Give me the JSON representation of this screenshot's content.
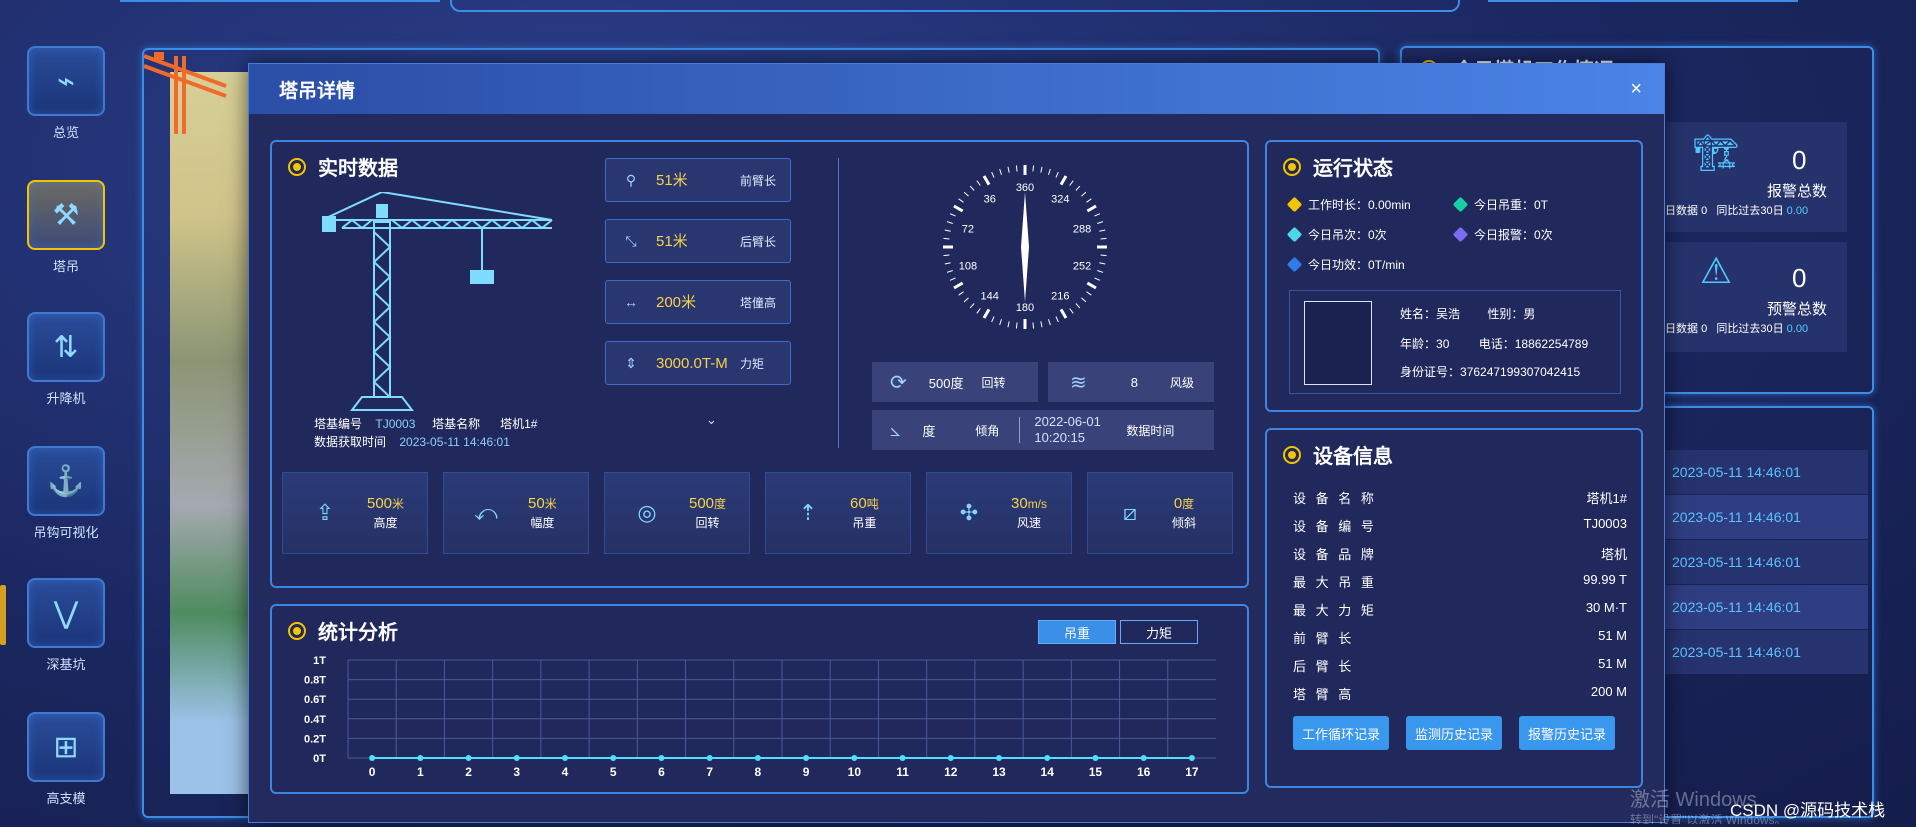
{
  "nav": [
    {
      "label": "总览",
      "icon": "monitor-icon"
    },
    {
      "label": "塔吊",
      "icon": "tower-crane-icon"
    },
    {
      "label": "升降机",
      "icon": "elevator-icon"
    },
    {
      "label": "吊钩可视化",
      "icon": "hook-icon"
    },
    {
      "label": "深基坑",
      "icon": "foundation-pit-icon"
    },
    {
      "label": "高支模",
      "icon": "formwork-icon"
    }
  ],
  "bg_right": {
    "title_partial": "今日塔机工作情况",
    "cards": [
      {
        "value": "0",
        "label": "报警总数",
        "today_label": "日数据",
        "today_value": "0",
        "compare_label": "同比过去30日",
        "compare_value": "0.00"
      },
      {
        "value": "0",
        "label": "预警总数",
        "today_label": "日数据",
        "today_value": "0",
        "compare_label": "同比过去30日",
        "compare_value": "0.00"
      }
    ],
    "times": [
      "2023-05-11 14:46:01",
      "2023-05-11 14:46:01",
      "2023-05-11 14:46:01",
      "2023-05-11 14:46:01",
      "2023-05-11 14:46:01"
    ]
  },
  "modal": {
    "title": "塔吊详情",
    "close": "×",
    "realtime": {
      "title": "实时数据",
      "params": [
        {
          "value": "51米",
          "label": "前臂长",
          "icon": "front-arm-icon"
        },
        {
          "value": "51米",
          "label": "后臂长",
          "icon": "rear-arm-icon"
        },
        {
          "value": "200米",
          "label": "塔僮高",
          "icon": "height-icon"
        },
        {
          "value": "3000.0T-M",
          "label": "力矩",
          "icon": "torque-icon"
        }
      ],
      "base_no_label": "塔基编号",
      "base_no": "TJ0003",
      "base_name_label": "塔基名称",
      "base_name": "塔机1#",
      "fetch_time_label": "数据获取时间",
      "fetch_time": "2023-05-11 14:46:01",
      "compass": {
        "ticks": [
          "180",
          "216",
          "252",
          "288",
          "324",
          "360",
          "36",
          "72",
          "108",
          "144"
        ]
      },
      "rotate": {
        "value": "500度",
        "label": "回转"
      },
      "wind": {
        "value": "8",
        "label": "风级"
      },
      "tilt": {
        "value": "度",
        "label": "倾角"
      },
      "data_time": {
        "value": "2022-06-01 10:20:15",
        "label": "数据时间"
      },
      "cards": [
        {
          "num": "500",
          "unit": "米",
          "label": "高度",
          "icon": "height-up-icon"
        },
        {
          "num": "50",
          "unit": "米",
          "label": "幅度",
          "icon": "range-icon"
        },
        {
          "num": "500",
          "unit": "度",
          "label": "回转",
          "icon": "rotate-icon"
        },
        {
          "num": "60",
          "unit": "吨",
          "label": "吊重",
          "icon": "load-icon"
        },
        {
          "num": "30",
          "unit": "m/s",
          "label": "风速",
          "icon": "fan-icon"
        },
        {
          "num": "0",
          "unit": "度",
          "label": "倾斜",
          "icon": "tilt-icon"
        }
      ]
    },
    "status": {
      "title": "运行状态",
      "items": [
        {
          "text": "工作时长：0.00min",
          "color": "#f3c400"
        },
        {
          "text": "今日吊重：0T",
          "color": "#19d0a6"
        },
        {
          "text": "今日吊次：0次",
          "color": "#4fd6e6"
        },
        {
          "text": "今日报警：0次",
          "color": "#7b6cf2"
        },
        {
          "text": "今日功效：0T/min",
          "color": "#2f7be8"
        }
      ],
      "operator": {
        "name_label": "姓名：",
        "name": "吴浩",
        "sex_label": "性别：",
        "sex": "男",
        "age_label": "年龄：",
        "age": "30",
        "phone_label": "电话：",
        "phone": "18862254789",
        "id_label": "身份证号：",
        "id": "376247199307042415"
      }
    },
    "device": {
      "title": "设备信息",
      "rows": [
        {
          "label": "设 备 名 称",
          "value": "塔机1#"
        },
        {
          "label": "设 备 编 号",
          "value": "TJ0003"
        },
        {
          "label": "设 备 品 牌",
          "value": "塔机"
        },
        {
          "label": "最 大 吊 重",
          "value": "99.99 T"
        },
        {
          "label": "最 大 力 矩",
          "value": "30 M·T"
        },
        {
          "label": "前 臂 长",
          "value": "51 M"
        },
        {
          "label": "后 臂 长",
          "value": "51 M"
        },
        {
          "label": "塔 臂 高",
          "value": "200 M"
        }
      ],
      "buttons": [
        "工作循环记录",
        "监测历史记录",
        "报警历史记录"
      ]
    },
    "stats": {
      "title": "统计分析",
      "toggles": [
        "吊重",
        "力矩"
      ]
    }
  },
  "chart_data": {
    "type": "line",
    "x": [
      0,
      1,
      2,
      3,
      4,
      5,
      6,
      7,
      8,
      9,
      10,
      11,
      12,
      13,
      14,
      15,
      16,
      17
    ],
    "series": [
      {
        "values": [
          0,
          0,
          0,
          0,
          0,
          0,
          0,
          0,
          0,
          0,
          0,
          0,
          0,
          0,
          0,
          0,
          0,
          0
        ]
      }
    ],
    "yticks": [
      "0T",
      "0.2T",
      "0.4T",
      "0.6T",
      "0.8T",
      "1T"
    ],
    "ylim": [
      0,
      1
    ],
    "grid": true,
    "color": "#4fe0ff"
  },
  "watermark": {
    "line1": "激活 Windows",
    "line2": "转到\"设置\"以激活 Windows。",
    "csdn": "CSDN @源码技术栈"
  }
}
